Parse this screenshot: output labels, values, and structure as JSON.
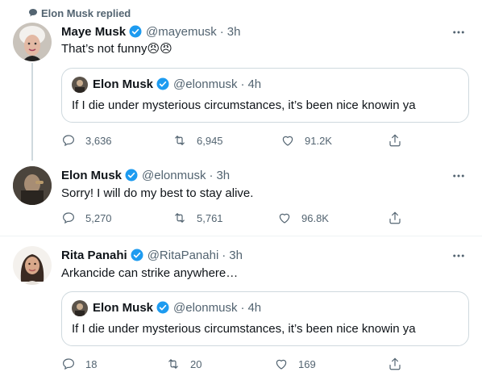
{
  "social_context": "Elon Musk replied",
  "tweets": [
    {
      "name": "Maye Musk",
      "handle": "@mayemusk",
      "time": "3h",
      "text": "That’s not funny😠😠",
      "quote": {
        "name": "Elon Musk",
        "handle": "@elonmusk",
        "time": "4h",
        "text": "If I die under mysterious circumstances, it’s been nice knowin ya"
      },
      "replies": "3,636",
      "retweets": "6,945",
      "likes": "91.2K"
    },
    {
      "name": "Elon Musk",
      "handle": "@elonmusk",
      "time": "3h",
      "text": "Sorry! I will do my best to stay alive.",
      "replies": "5,270",
      "retweets": "5,761",
      "likes": "96.8K"
    },
    {
      "name": "Rita Panahi",
      "handle": "@RitaPanahi",
      "time": "3h",
      "text": "Arkancide can strike anywhere…",
      "quote": {
        "name": "Elon Musk",
        "handle": "@elonmusk",
        "time": "4h",
        "text": "If I die under mysterious circumstances, it’s been nice knowin ya"
      },
      "replies": "18",
      "retweets": "20",
      "likes": "169"
    }
  ],
  "separator": "·",
  "colors": {
    "verified": "#1d9bf0",
    "muted": "#536471",
    "text": "#0f1419",
    "border": "#cfd9de"
  },
  "icons": [
    "speech-bubble-icon",
    "verified-badge-icon",
    "more-options-icon",
    "reply-icon",
    "retweet-icon",
    "like-icon",
    "share-icon"
  ]
}
